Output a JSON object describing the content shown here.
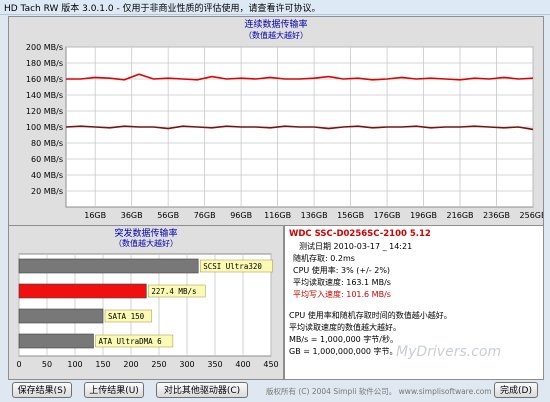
{
  "window": {
    "title": "HD Tach RW 版本 3.0.1.0  - 仅用于非商业性质的评估使用，请查看许可协议。"
  },
  "seq_chart": {
    "title": "连续数据传输率",
    "subtitle": "（数值越大越好）",
    "y_ticks": [
      "200 MB/s",
      "180 MB/s",
      "160 MB/s",
      "140 MB/s",
      "120 MB/s",
      "100 MB/s",
      "80 MB/s",
      "60 MB/s",
      "40 MB/s",
      "20 MB/s"
    ],
    "x_ticks": [
      "16GB",
      "36GB",
      "56GB",
      "76GB",
      "96GB",
      "116GB",
      "136GB",
      "156GB",
      "176GB",
      "196GB",
      "216GB",
      "236GB",
      "256GB"
    ],
    "colors": {
      "read": "#e00000",
      "write": "#7a1010"
    }
  },
  "chart_data": [
    {
      "type": "line",
      "title": "连续数据传输率",
      "subtitle": "（数值越大越好）",
      "xlabel": "",
      "ylabel": "",
      "ylim": [
        0,
        200
      ],
      "xlim": [
        0,
        256
      ],
      "grid": true,
      "x": [
        0,
        8,
        16,
        24,
        32,
        40,
        48,
        56,
        64,
        72,
        80,
        88,
        96,
        104,
        112,
        120,
        128,
        136,
        144,
        152,
        160,
        168,
        176,
        184,
        192,
        200,
        208,
        216,
        224,
        232,
        240,
        248,
        256
      ],
      "series": [
        {
          "values": [
            160,
            160,
            162,
            161,
            159,
            166,
            160,
            161,
            160,
            159,
            163,
            160,
            161,
            160,
            162,
            160,
            160,
            161,
            163,
            160,
            161,
            159,
            160,
            162,
            160,
            161,
            160,
            159,
            161,
            160,
            162,
            160,
            161
          ]
        },
        {
          "values": [
            100,
            101,
            100,
            99,
            101,
            100,
            100,
            98,
            101,
            100,
            99,
            101,
            100,
            100,
            99,
            101,
            100,
            100,
            98,
            100,
            101,
            99,
            100,
            100,
            101,
            99,
            100,
            100,
            101,
            100,
            99,
            100,
            97
          ]
        }
      ]
    },
    {
      "type": "bar",
      "title": "突发数据传输率",
      "subtitle": "（数值越大越好）",
      "xlabel": "",
      "ylabel": "",
      "xlim": [
        0,
        450
      ],
      "categories": [
        "SCSI Ultra320",
        "227.4 MB/s",
        "SATA 150",
        "ATA UltraDMA 6"
      ],
      "values": [
        320,
        227.4,
        150,
        133
      ]
    }
  ],
  "burst_chart": {
    "title": "突发数据传输率",
    "subtitle": "（数值越大越好）",
    "x_ticks": [
      "0",
      "50",
      "100",
      "150",
      "200",
      "250",
      "300",
      "350",
      "400",
      "450"
    ],
    "bars": [
      {
        "label": "SCSI Ultra320",
        "value": 320,
        "color": "#787878"
      },
      {
        "label": "227.4 MB/s",
        "value": 227.4,
        "color": "#f01010"
      },
      {
        "label": "SATA 150",
        "value": 150,
        "color": "#787878"
      },
      {
        "label": "ATA UltraDMA 6",
        "value": 133,
        "color": "#787878"
      }
    ]
  },
  "info": {
    "drive_name": "WDC SSC-D0256SC-2100 5.12",
    "test_date": "测试日期 2010-03-17 _ 14:21",
    "random_access": "随机存取: 0.2ms",
    "cpu_usage": "CPU 使用率: 3% (+/- 2%)",
    "avg_read": "平均读取速度: 163.1 MB/s",
    "avg_write": "平均写入速度: 101.6 MB/s",
    "note1": "CPU 使用率和随机存取时间的数值越小越好。",
    "note2": "平均读取速度的数值越大越好。",
    "note3": "MB/s = 1,000,000 字节/秒。",
    "note4": "GB = 1,000,000,000 字节。"
  },
  "buttons": {
    "save": "保存结果(S)",
    "upload": "上传结果(U)",
    "compare": "对比其他驱动器(C)",
    "done": "完成(D)"
  },
  "credits": "版权所有 (C) 2004 Simpli 软件公司。 www.simplisoftware.com",
  "watermark": "MyDrivers.com"
}
